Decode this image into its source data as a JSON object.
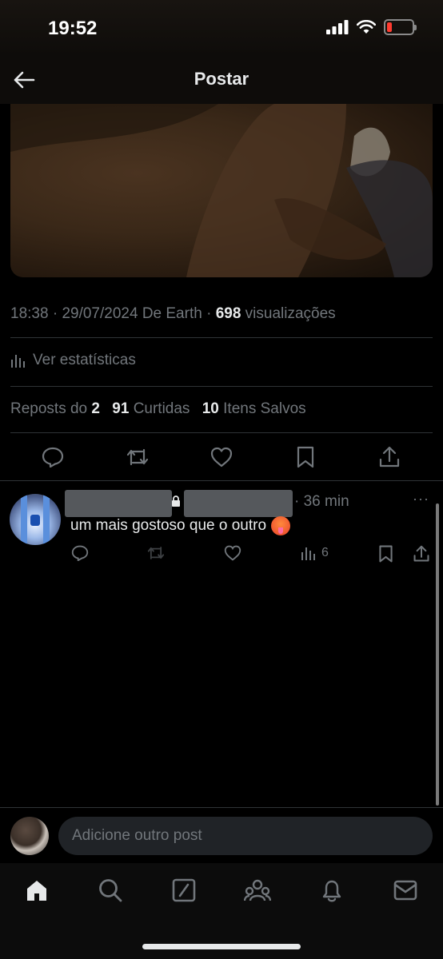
{
  "status_bar": {
    "time": "19:52"
  },
  "header": {
    "title": "Postar"
  },
  "post_meta": {
    "time": "18:38",
    "date": "29/07/2024",
    "source": "De Earth",
    "views_count": "698",
    "views_label": "visualizações"
  },
  "stats_link": {
    "label": "Ver estatísticas"
  },
  "counts": {
    "reposts_label": "Reposts do",
    "reposts": "2",
    "likes": "91",
    "likes_label": "Curtidas",
    "saves": "10",
    "saves_label": "Itens Salvos"
  },
  "reply": {
    "time": "· 36 min",
    "text": "um mais gostoso que o outro",
    "views": "6",
    "more": "···"
  },
  "composer": {
    "placeholder": "Adicione outro post"
  },
  "colors": {
    "background": "#000000",
    "text_secondary": "#71767b",
    "text_primary": "#e7e9ea",
    "battery_low": "#ff3b30"
  },
  "icons": [
    "back-arrow-icon",
    "signal-icon",
    "wifi-icon",
    "battery-icon",
    "stats-icon",
    "reply-icon",
    "repost-icon",
    "like-icon",
    "bookmark-icon",
    "share-icon",
    "home-icon",
    "search-icon",
    "grok-icon",
    "communities-icon",
    "notifications-icon",
    "messages-icon"
  ]
}
